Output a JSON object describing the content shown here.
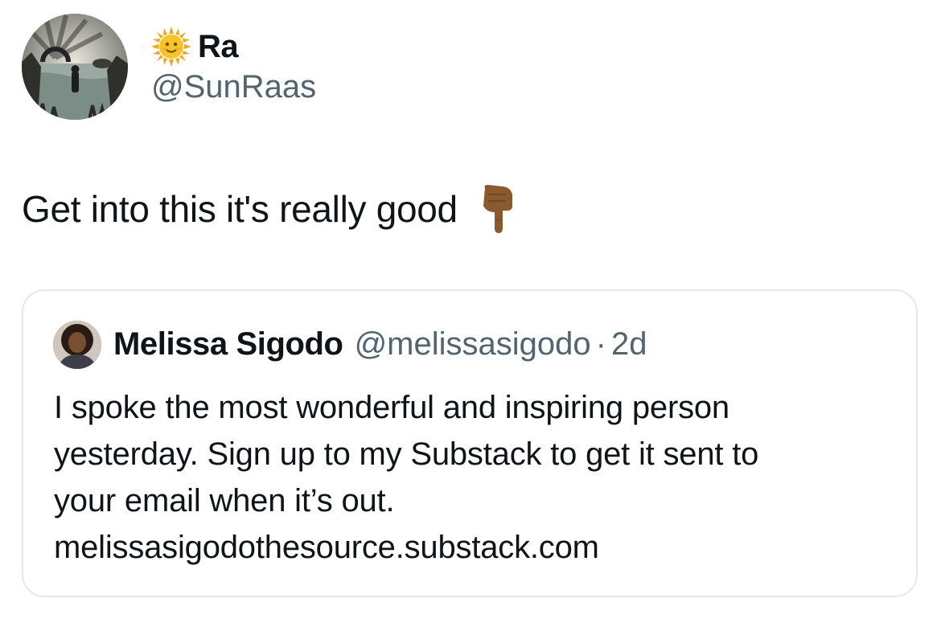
{
  "author": {
    "display_name": "Ra",
    "handle": "@SunRaas",
    "name_emoji": "sun-with-face-icon"
  },
  "tweet": {
    "text": "Get into this it's really good",
    "trailing_emoji": "backhand-index-pointing-down-icon"
  },
  "quoted_tweet": {
    "display_name": "Melissa Sigodo",
    "handle": "@melissasigodo",
    "separator": "·",
    "time": "2d",
    "lines": [
      "I spoke the most wonderful and inspiring person",
      "yesterday. Sign up to my Substack to get it sent to",
      "your email when it’s out.",
      "melissasigodothesource.substack.com"
    ]
  },
  "colors": {
    "text_primary": "#0f1419",
    "text_secondary": "#536471",
    "card_border": "#e6e9ec",
    "sun_yellow": "#f7c325",
    "hand_skin": "#8a5a2e"
  }
}
